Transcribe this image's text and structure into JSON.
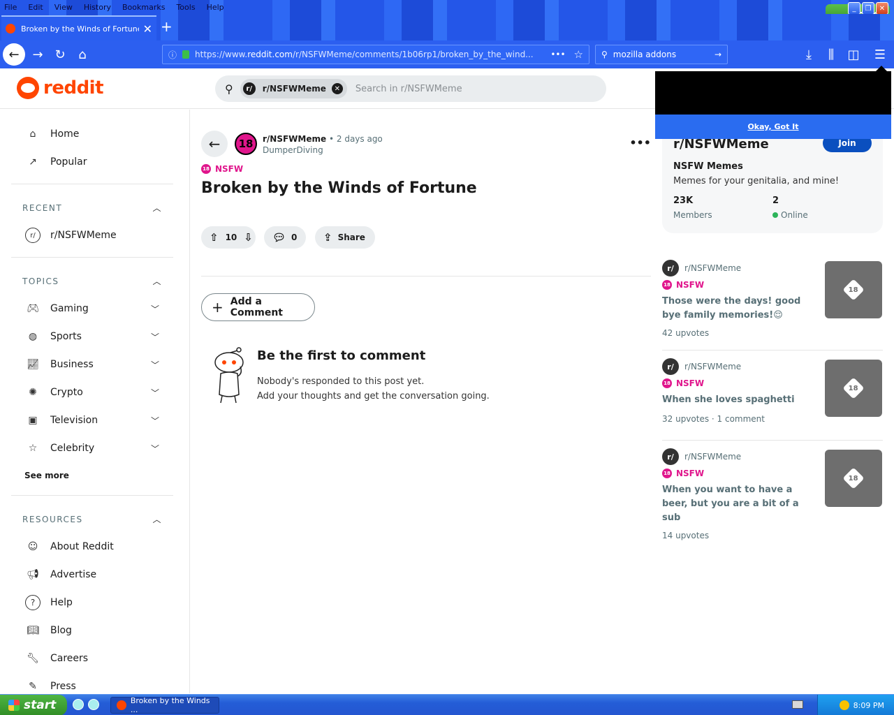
{
  "browser": {
    "menu": [
      "File",
      "Edit",
      "View",
      "History",
      "Bookmarks",
      "Tools",
      "Help"
    ],
    "xp_start_label": "start",
    "tab_title": "Broken by the Winds of Fortune :",
    "url_prefix": "https://www.",
    "url_domain": "reddit.com",
    "url_rest": "/r/NSFWMeme/comments/1b06rp1/broken_by_the_wind...",
    "search_text": "mozilla addons"
  },
  "reddit": {
    "logo_text": "reddit",
    "search": {
      "chip_label": "r/NSFWMeme",
      "placeholder": "Search in r/NSFWMeme"
    }
  },
  "sidebar": {
    "main": [
      {
        "label": "Home",
        "icon": "home-icon"
      },
      {
        "label": "Popular",
        "icon": "popular-icon"
      }
    ],
    "recent_heading": "RECENT",
    "recent": [
      {
        "label": "r/NSFWMeme"
      }
    ],
    "topics_heading": "TOPICS",
    "topics": [
      {
        "label": "Gaming",
        "icon": "gamepad-icon"
      },
      {
        "label": "Sports",
        "icon": "sports-icon"
      },
      {
        "label": "Business",
        "icon": "business-icon"
      },
      {
        "label": "Crypto",
        "icon": "crypto-icon"
      },
      {
        "label": "Television",
        "icon": "television-icon"
      },
      {
        "label": "Celebrity",
        "icon": "star-icon"
      }
    ],
    "see_more": "See more",
    "resources_heading": "RESOURCES",
    "resources": [
      {
        "label": "About Reddit",
        "icon": "about-icon"
      },
      {
        "label": "Advertise",
        "icon": "megaphone-icon"
      },
      {
        "label": "Help",
        "icon": "help-icon"
      },
      {
        "label": "Blog",
        "icon": "book-icon"
      },
      {
        "label": "Careers",
        "icon": "wrench-icon"
      },
      {
        "label": "Press",
        "icon": "press-icon"
      }
    ]
  },
  "post": {
    "subreddit": "r/NSFWMeme",
    "avatar_text": "18",
    "time": "• 2 days ago",
    "author": "DumperDiving",
    "nsfw_label": "NSFW",
    "title": "Broken by the Winds of Fortune",
    "score": "10",
    "comments": "0",
    "share_label": "Share",
    "add_comment_label": "Add a Comment",
    "empty_title": "Be the first to comment",
    "empty_line1": "Nobody's responded to this post yet.",
    "empty_line2": "Add your thoughts and get the conversation going."
  },
  "popup": {
    "ok_label": "Okay, Got It"
  },
  "community": {
    "name": "r/NSFWMeme",
    "join_label": "Join",
    "title": "NSFW Memes",
    "description": "Memes for your genitalia, and mine!",
    "members_value": "23K",
    "members_label": "Members",
    "online_value": "2",
    "online_label": "Online"
  },
  "related": [
    {
      "subreddit": "r/NSFWMeme",
      "nsfw": "NSFW",
      "title": "Those were the days! good bye family memories!😌",
      "stats": "42 upvotes",
      "thumb": "18"
    },
    {
      "subreddit": "r/NSFWMeme",
      "nsfw": "NSFW",
      "title": "When she loves spaghetti",
      "stats": "32 upvotes · 1 comment",
      "thumb": "18"
    },
    {
      "subreddit": "r/NSFWMeme",
      "nsfw": "NSFW",
      "title": "When you want to have a beer, but you are a bit of a sub",
      "stats": "14 upvotes",
      "thumb": "18"
    }
  ],
  "taskbar": {
    "start_label": "start",
    "task_label": "Broken by the Winds ...",
    "clock": "8:09 PM"
  }
}
